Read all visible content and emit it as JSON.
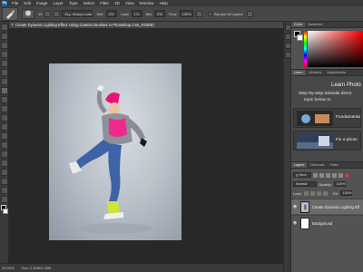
{
  "menubar": {
    "logo": "Ps",
    "items": [
      "File",
      "Edit",
      "Image",
      "Layer",
      "Type",
      "Select",
      "Filter",
      "3D",
      "View",
      "Window",
      "Help"
    ]
  },
  "options": {
    "brush_size": "45",
    "preset_name": "Dry, Heavy Load",
    "wet_label": "Wet:",
    "wet_value": "0%",
    "load_label": "Load:",
    "load_value": "1%",
    "mix_label": "Mix:",
    "mix_value": "0%",
    "flow_label": "Flow:",
    "flow_value": "100%",
    "sample_label": "Sample All Layers"
  },
  "document": {
    "tab_title": "Create Dynamic Lighting Effect Using Custom Brushes in Photoshop CS5_RGB/8)"
  },
  "status": {
    "zoom": "33.33%",
    "doc_info": "Doc: 2.30M/2.30M"
  },
  "color_panel": {
    "tabs": [
      "Color",
      "Swatches"
    ],
    "foreground": "#000000",
    "background": "#ffffff"
  },
  "learn_panel": {
    "tabs": [
      "Learn",
      "Libraries",
      "Adjustments"
    ],
    "title": "Learn Photo",
    "subtitle_line1": "Step-by-step tutorials direct",
    "subtitle_line2": "topic below to",
    "cards": [
      {
        "label": "Fundamenta"
      },
      {
        "label": "Fix a photo"
      }
    ]
  },
  "layers_panel": {
    "tabs": [
      "Layers",
      "Channels",
      "Paths"
    ],
    "filter_kind": "Kind",
    "blend_mode": "Normal",
    "opacity_label": "Opacity:",
    "opacity_value": "100%",
    "lock_label": "Lock:",
    "fill_label": "Fill:",
    "fill_value": "100%",
    "layers": [
      {
        "name": "Create Dynamic Lighting Eff...",
        "selected": true
      },
      {
        "name": "Background",
        "selected": false
      }
    ]
  }
}
